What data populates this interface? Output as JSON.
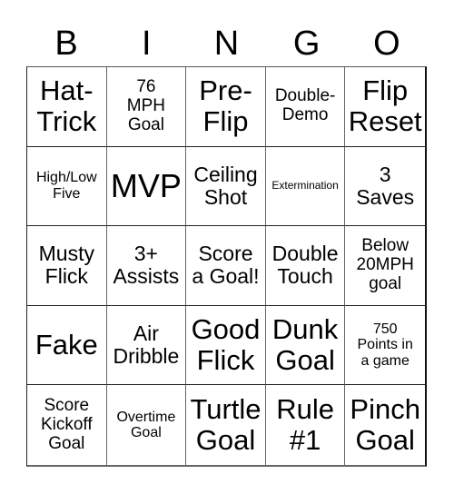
{
  "header": {
    "letters": [
      "B",
      "I",
      "N",
      "G",
      "O"
    ]
  },
  "cells": [
    {
      "text": "Hat-\nTrick",
      "size": "s-lg"
    },
    {
      "text": "76\nMPH\nGoal",
      "size": "s-sm"
    },
    {
      "text": "Pre-\nFlip",
      "size": "s-lg"
    },
    {
      "text": "Double-\nDemo",
      "size": "s-sm"
    },
    {
      "text": "Flip\nReset",
      "size": "s-lg"
    },
    {
      "text": "High/Low\nFive",
      "size": "s-xs"
    },
    {
      "text": "MVP",
      "size": "s-xl"
    },
    {
      "text": "Ceiling\nShot",
      "size": "s-md"
    },
    {
      "text": "Extermination",
      "size": "s-xxs"
    },
    {
      "text": "3\nSaves",
      "size": "s-md"
    },
    {
      "text": "Musty\nFlick",
      "size": "s-md"
    },
    {
      "text": "3+\nAssists",
      "size": "s-md"
    },
    {
      "text": "Score\na Goal!",
      "size": "s-md"
    },
    {
      "text": "Double\nTouch",
      "size": "s-md"
    },
    {
      "text": "Below\n20MPH\ngoal",
      "size": "s-sm"
    },
    {
      "text": "Fake",
      "size": "s-lg"
    },
    {
      "text": "Air\nDribble",
      "size": "s-md"
    },
    {
      "text": "Good\nFlick",
      "size": "s-lg"
    },
    {
      "text": "Dunk\nGoal",
      "size": "s-lg"
    },
    {
      "text": "750\nPoints in\na game",
      "size": "s-xs"
    },
    {
      "text": "Score\nKickoff\nGoal",
      "size": "s-sm"
    },
    {
      "text": "Overtime\nGoal",
      "size": "s-xs"
    },
    {
      "text": "Turtle\nGoal",
      "size": "s-lg"
    },
    {
      "text": "Rule\n#1",
      "size": "s-lg"
    },
    {
      "text": "Pinch\nGoal",
      "size": "s-lg"
    }
  ]
}
